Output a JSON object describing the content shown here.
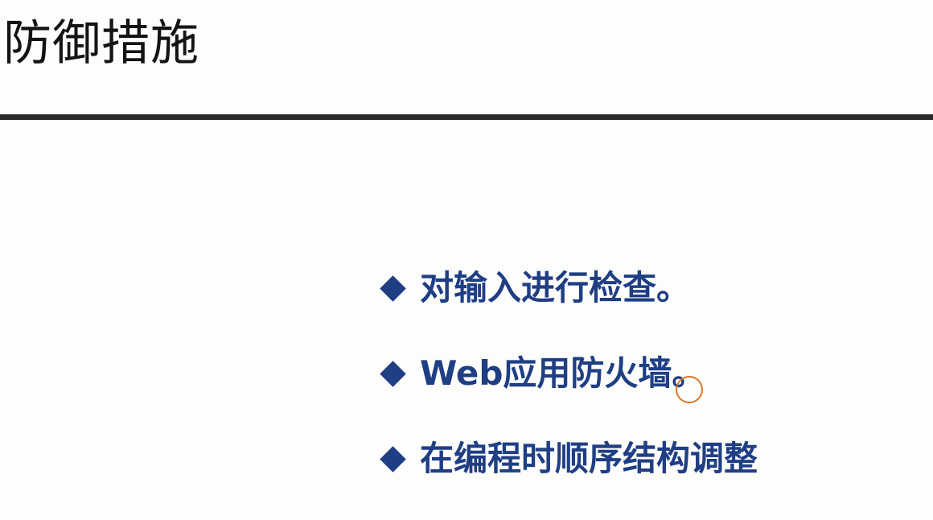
{
  "slide": {
    "title": "防御措施",
    "bullets": [
      {
        "text": "对输入进行检查。"
      },
      {
        "text": "Web应用防火墙。"
      },
      {
        "text": "在编程时顺序结构调整"
      }
    ]
  },
  "colors": {
    "title_text": "#141414",
    "rule": "#2b2b2b",
    "bullet_accent": "#1f3e84",
    "cursor_ring": "#d9772a",
    "background": "#fdfdfc"
  },
  "icons": {
    "bullet_marker": "diamond-bullet-icon",
    "pointer": "mouse-cursor-ring-icon"
  }
}
